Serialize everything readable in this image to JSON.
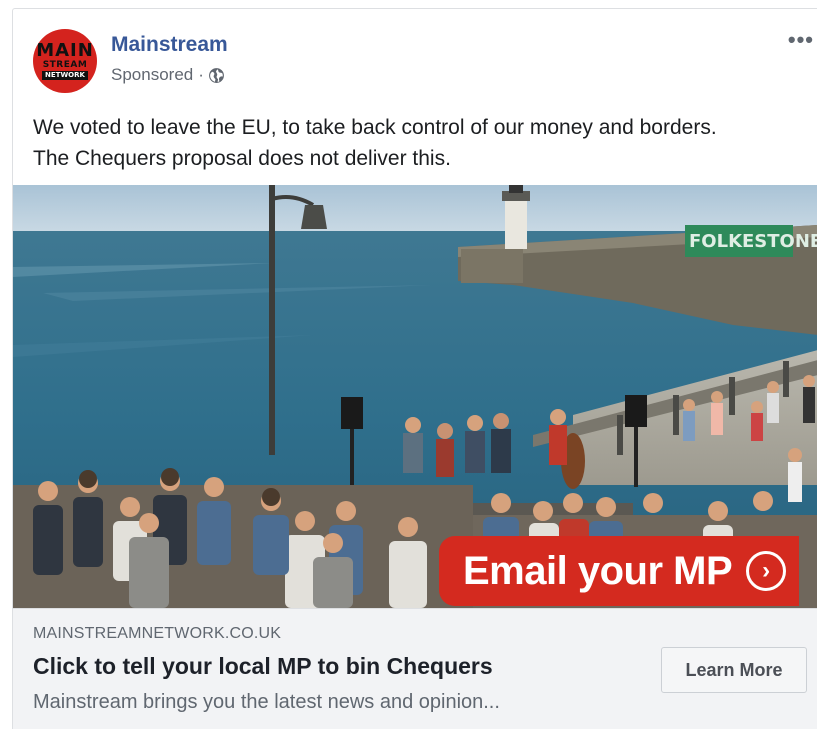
{
  "post": {
    "page_name": "Mainstream",
    "sponsored_label": "Sponsored",
    "separator": "·",
    "audience_icon": "globe-icon",
    "more_icon": "•••",
    "avatar": {
      "line1": "MAIN",
      "line2": "STREAM",
      "line3": "NETWORK",
      "color": "#d4231e"
    },
    "text_line1": "We voted to leave the EU, to take back control of our money and borders.",
    "text_line2": "The Chequers proposal does not deliver this."
  },
  "image": {
    "description_icon": "harbour-concert-photo",
    "sign_text": "FOLKESTONE",
    "cta_text": "Email your MP",
    "cta_arrow": "›",
    "cta_color": "#d42a1f"
  },
  "link_preview": {
    "domain": "MAINSTREAMNETWORK.CO.UK",
    "title": "Click to tell your local MP to bin Chequers",
    "description": "Mainstream brings you the latest news and opinion...",
    "button_label": "Learn More"
  },
  "colors": {
    "link_blue": "#385898",
    "meta_gray": "#616770",
    "footer_bg": "#f2f3f5"
  }
}
